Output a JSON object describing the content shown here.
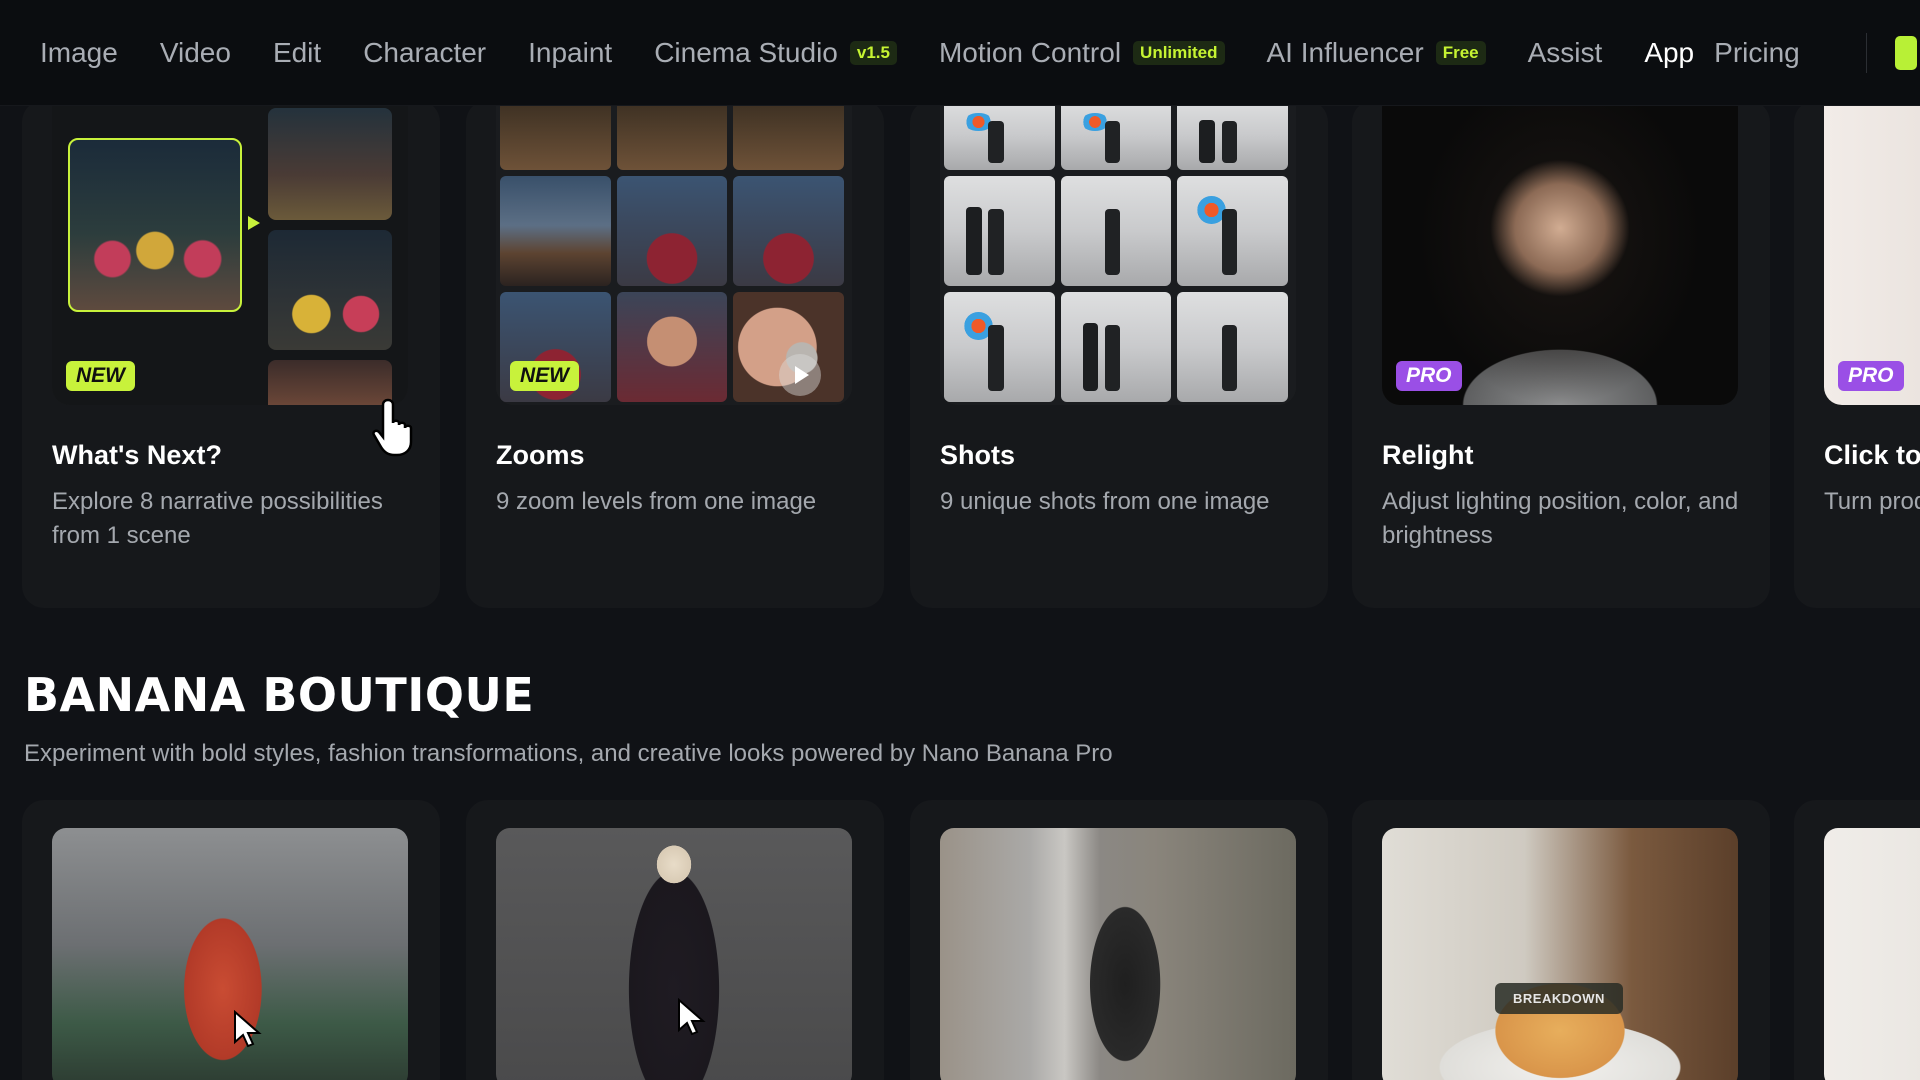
{
  "nav": {
    "items": [
      {
        "label": "Image"
      },
      {
        "label": "Video"
      },
      {
        "label": "Edit"
      },
      {
        "label": "Character"
      },
      {
        "label": "Inpaint"
      },
      {
        "label": "Cinema Studio",
        "badge": "v1.5"
      },
      {
        "label": "Motion Control",
        "badge": "Unlimited"
      },
      {
        "label": "AI Influencer",
        "badge": "Free"
      },
      {
        "label": "Assist"
      },
      {
        "label": "App"
      },
      {
        "label": "Pricing"
      }
    ]
  },
  "tools": [
    {
      "title": "What's Next?",
      "desc": "Explore 8 narrative possibilities from 1 scene",
      "tag": "NEW"
    },
    {
      "title": "Zooms",
      "desc": "9 zoom levels from one image",
      "tag": "NEW"
    },
    {
      "title": "Shots",
      "desc": "9 unique shots from one image",
      "tag": ""
    },
    {
      "title": "Relight",
      "desc": "Adjust lighting position, color, and brightness",
      "tag": "PRO"
    },
    {
      "title": "Click to",
      "desc": "Turn prod professio",
      "tag": "PRO"
    }
  ],
  "section": {
    "title": "BANANA BOUTIQUE",
    "desc": "Experiment with bold styles, fashion transformations, and creative looks powered by Nano Banana Pro"
  },
  "boutique": {
    "card4_overlay": "BREAKDOWN"
  },
  "colors": {
    "accent": "#c8f23b",
    "pro": "#9a4fe6",
    "background": "#101216"
  }
}
